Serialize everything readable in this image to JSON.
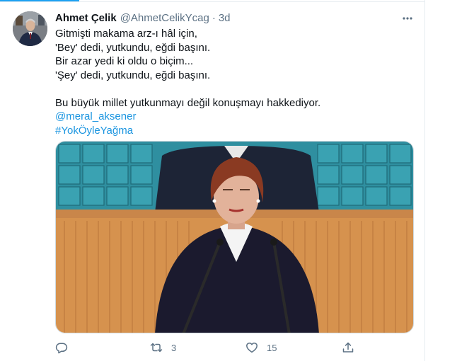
{
  "tweet": {
    "author_name": "Ahmet Çelik",
    "author_handle": "@AhmetCelikYcag",
    "separator": "·",
    "time": "3d",
    "lines": [
      "Gitmişti makama arz-ı hâl için,",
      "'Bey' dedi, yutkundu, eğdi başını.",
      "Bir azar yedi ki oldu o biçim...",
      "'Şey' dedi, yutkundu, eğdi başını.",
      "Bu büyük millet yutkunmayı değil konuşmayı hakkediyor."
    ],
    "mention": "@meral_aksener",
    "hashtag": "#YokÖyleYağma"
  },
  "actions": {
    "reply": {
      "icon": "reply-icon"
    },
    "retweet": {
      "icon": "retweet-icon",
      "count": "3"
    },
    "like": {
      "icon": "heart-icon",
      "count": "15"
    },
    "share": {
      "icon": "share-icon"
    }
  },
  "icons": {
    "more": "more-options-icon",
    "avatar": "user-avatar"
  },
  "colors": {
    "text": "#0f1419",
    "secondary": "#5b7083",
    "link": "#1b95e0",
    "accent": "#1da1f2"
  }
}
